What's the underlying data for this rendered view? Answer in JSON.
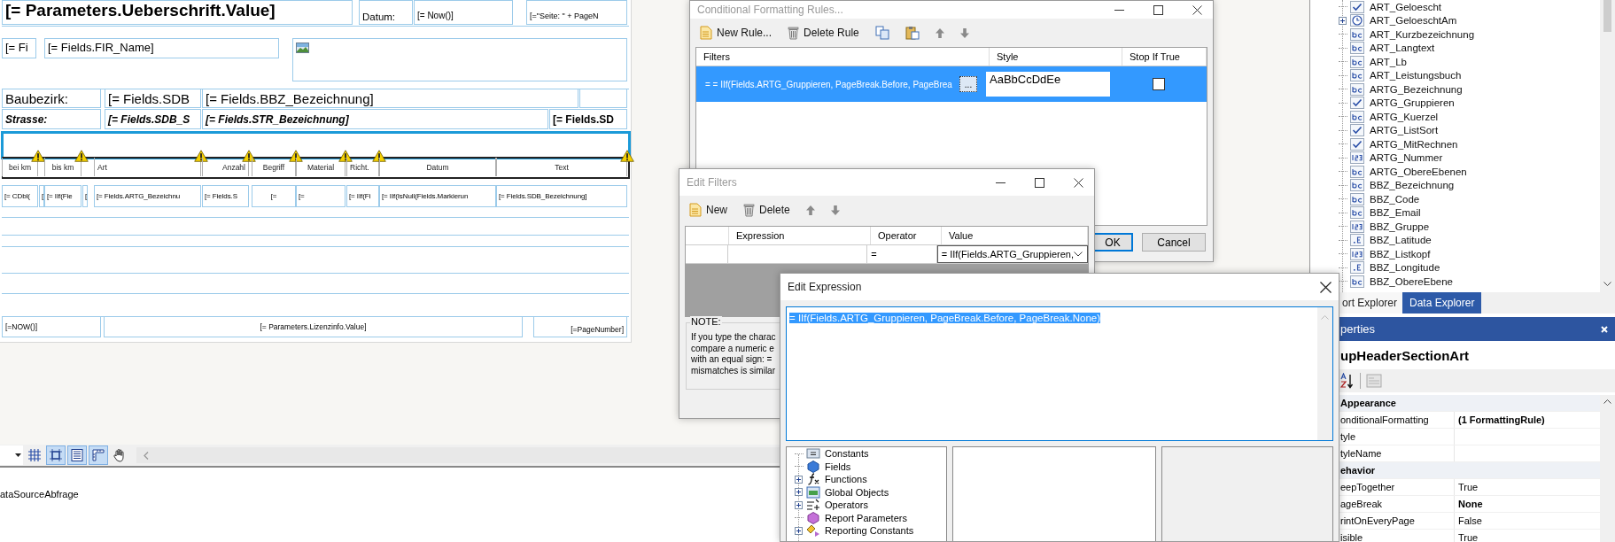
{
  "report_designer": {
    "bands": [
      {
        "kind": "page_header",
        "controls": [
          {
            "text": "[= Parameters.Ueberschrift.Value]"
          },
          {
            "text": "Datum:"
          },
          {
            "text": "[= Now()]"
          },
          {
            "text": "[=\"Seite: \" + PageN"
          }
        ]
      },
      {
        "kind": "company",
        "controls": [
          {
            "text": "[= Fi"
          },
          {
            "text": "[= Fields.FIR_Name]"
          }
        ]
      },
      {
        "kind": "district",
        "controls": [
          {
            "text": "Baubezirk:"
          },
          {
            "text": "[= Fields.SDB"
          },
          {
            "text": "[= Fields.BBZ_Bezeichnung]"
          }
        ]
      },
      {
        "kind": "street",
        "controls": [
          {
            "text": "Strasse:"
          },
          {
            "text": "[= Fields.SDB_S"
          },
          {
            "text": "[= Fields.STR_Bezeichnung]"
          },
          {
            "text": "[= Fields.SD"
          }
        ]
      },
      {
        "kind": "column_headers",
        "controls": [
          {
            "text": "bei km",
            "warning": true
          },
          {
            "text": "bis km",
            "warning": true
          },
          {
            "text": "Art",
            "warning": true
          },
          {
            "text": "Anzahl",
            "warning": true
          },
          {
            "text": "Begriff",
            "warning": true
          },
          {
            "text": "Material",
            "warning": true
          },
          {
            "text": "Richt.",
            "warning": true
          },
          {
            "text": "Datum",
            "warning": false
          },
          {
            "text": "Text",
            "warning": true
          }
        ]
      },
      {
        "kind": "detail",
        "controls": [
          {
            "text": "[= CDbl("
          },
          {
            "text": "["
          },
          {
            "text": "[= IIf(Fie"
          },
          {
            "text": "["
          },
          {
            "text": "[= Fields.ARTG_Bezeichnu"
          },
          {
            "text": "[= Fields.S"
          },
          {
            "text": "[="
          },
          {
            "text": "[="
          },
          {
            "text": "[= IIf(Fi"
          },
          {
            "text": "[= IIf(IsNull(Fields.Markierun"
          },
          {
            "text": "[= Fields.SDB_Bezeichnung]"
          }
        ]
      },
      {
        "kind": "page_footer",
        "controls": [
          {
            "text": "[=NOW()]"
          },
          {
            "text": "[= Parameters.Lizenzinfo.Value]"
          },
          {
            "text": "[=PageNumber]"
          }
        ]
      }
    ],
    "toolbar": [
      {
        "kind": "grid",
        "on": false
      },
      {
        "kind": "snap",
        "on": true
      },
      {
        "kind": "bands",
        "on": true
      },
      {
        "kind": "ruler",
        "on": true
      },
      {
        "kind": "hand",
        "on": false
      }
    ],
    "bottom_panel": {
      "text": "ataSourceAbfrage"
    }
  },
  "conditional_formatting_dialog": {
    "title": "Conditional Formatting Rules...",
    "toolbar": [
      {
        "kind": "new",
        "label": "New Rule..."
      },
      {
        "kind": "delete",
        "label": "Delete Rule"
      },
      {
        "kind": "copy"
      },
      {
        "kind": "paste"
      },
      {
        "kind": "up"
      },
      {
        "kind": "down"
      }
    ],
    "columns": [
      "Filters",
      "Style",
      "Stop If True"
    ],
    "rules": [
      {
        "filter": "= = IIf(Fields.ARTG_Gruppieren, PageBreak.Before, PageBrea",
        "edit_button": "...",
        "style_preview": "AaBbCcDdEe",
        "stop_if_true": false,
        "selected": true
      }
    ],
    "buttons": [
      {
        "label": "OK",
        "default": true
      },
      {
        "label": "Cancel",
        "default": false
      }
    ]
  },
  "edit_filters_dialog": {
    "title": "Edit Filters",
    "toolbar": [
      {
        "kind": "new",
        "label": "New"
      },
      {
        "kind": "delete",
        "label": "Delete"
      },
      {
        "kind": "up"
      },
      {
        "kind": "down"
      }
    ],
    "columns": [
      "Expression",
      "Operator",
      "Value"
    ],
    "rows": [
      {
        "operator": "=",
        "value": "= IIf(Fields.ARTG_Gruppieren,"
      }
    ],
    "note_title": "NOTE:",
    "note_lines": [
      "If you type the charac",
      "compare a numeric e",
      "with an equal sign: =",
      "mismatches is similar"
    ]
  },
  "edit_expression_dialog": {
    "title": "Edit Expression",
    "expression": "= IIf(Fields.ARTG_Gruppieren, PageBreak.Before, PageBreak.None)",
    "expression_selected": true,
    "tree": [
      {
        "label": "Constants",
        "kind": "constants",
        "expandable": false
      },
      {
        "label": "Fields",
        "kind": "fields",
        "expandable": false
      },
      {
        "label": "Functions",
        "kind": "functions",
        "expandable": true
      },
      {
        "label": "Global Objects",
        "kind": "globals",
        "expandable": true
      },
      {
        "label": "Operators",
        "kind": "operators",
        "expandable": true
      },
      {
        "label": "Report Parameters",
        "kind": "parameters",
        "expandable": false
      },
      {
        "label": "Reporting Constants",
        "kind": "reporting",
        "expandable": true
      }
    ]
  },
  "data_explorer": {
    "fields": [
      {
        "name": "ART_Geloescht",
        "kind": "bool",
        "expandable": false
      },
      {
        "name": "ART_GeloeschtAm",
        "kind": "date",
        "expandable": true
      },
      {
        "name": "ART_Kurzbezeichnung",
        "kind": "string",
        "expandable": false
      },
      {
        "name": "ART_Langtext",
        "kind": "string",
        "expandable": false
      },
      {
        "name": "ART_Lb",
        "kind": "string",
        "expandable": false
      },
      {
        "name": "ART_Leistungsbuch",
        "kind": "string",
        "expandable": false
      },
      {
        "name": "ARTG_Bezeichnung",
        "kind": "string",
        "expandable": false
      },
      {
        "name": "ARTG_Gruppieren",
        "kind": "bool",
        "expandable": false
      },
      {
        "name": "ARTG_Kuerzel",
        "kind": "string",
        "expandable": false
      },
      {
        "name": "ARTG_ListSort",
        "kind": "bool",
        "expandable": false
      },
      {
        "name": "ARTG_MitRechnen",
        "kind": "bool",
        "expandable": false
      },
      {
        "name": "ARTG_Nummer",
        "kind": "number",
        "expandable": false
      },
      {
        "name": "ARTG_ObereEbenen",
        "kind": "string",
        "expandable": false
      },
      {
        "name": "BBZ_Bezeichnung",
        "kind": "string",
        "expandable": false
      },
      {
        "name": "BBZ_Code",
        "kind": "string",
        "expandable": false
      },
      {
        "name": "BBZ_Email",
        "kind": "string",
        "expandable": false
      },
      {
        "name": "BBZ_Gruppe",
        "kind": "number",
        "expandable": false
      },
      {
        "name": "BBZ_Latitude",
        "kind": "decimal",
        "expandable": false
      },
      {
        "name": "BBZ_Listkopf",
        "kind": "number",
        "expandable": false
      },
      {
        "name": "BBZ_Longitude",
        "kind": "decimal",
        "expandable": false
      },
      {
        "name": "BBZ_ObereEbene",
        "kind": "string",
        "expandable": false
      }
    ],
    "tabs": [
      {
        "label": "ort Explorer",
        "selected": false
      },
      {
        "label": "Data Explorer",
        "selected": true
      }
    ]
  },
  "properties": {
    "title": "perties",
    "object": "upHeaderSectionArt",
    "rows": [
      {
        "kind": "category",
        "name": "Appearance"
      },
      {
        "kind": "property",
        "name": "onditionalFormatting",
        "value": "(1 FormattingRule)",
        "bold": true
      },
      {
        "kind": "property",
        "name": "tyle"
      },
      {
        "kind": "property",
        "name": "tyleName"
      },
      {
        "kind": "category",
        "name": "ehavior"
      },
      {
        "kind": "property",
        "name": "eepTogether",
        "value": "True",
        "bold": false
      },
      {
        "kind": "property",
        "name": "ageBreak",
        "value": "None",
        "bold": true
      },
      {
        "kind": "property",
        "name": "rintOnEveryPage",
        "value": "False",
        "bold": false
      },
      {
        "kind": "property",
        "name": "isible",
        "value": "True",
        "bold": false
      }
    ]
  }
}
